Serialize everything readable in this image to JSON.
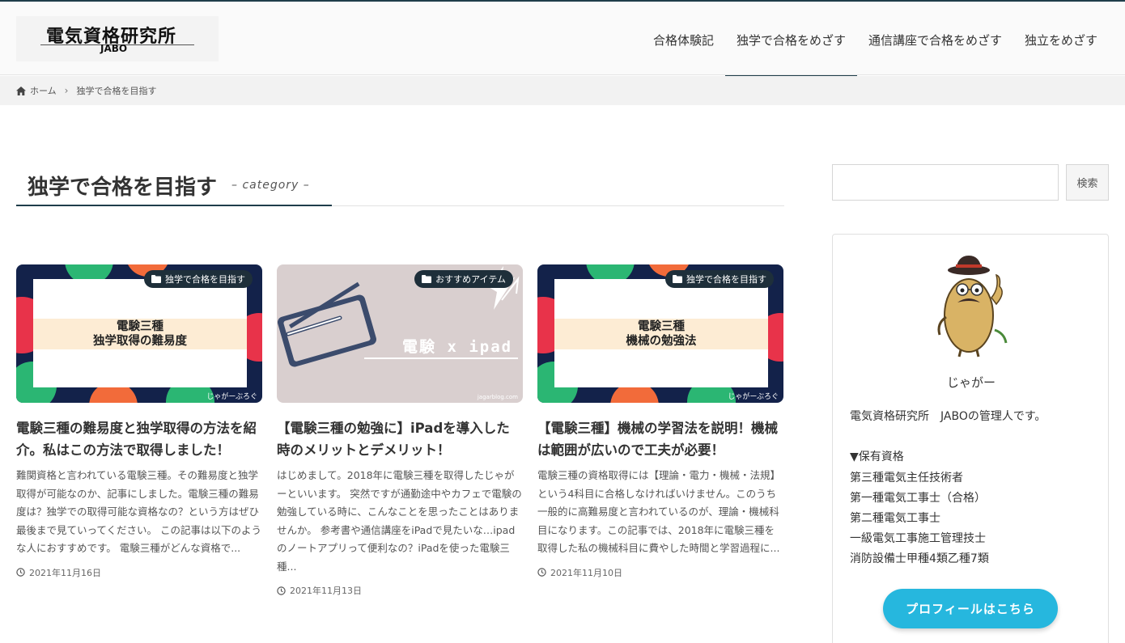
{
  "header": {
    "logo_title": "電気資格研究所",
    "logo_sub": "JABO",
    "nav": [
      {
        "label": "合格体験記"
      },
      {
        "label": "独学で合格をめざす"
      },
      {
        "label": "通信講座で合格をめざす"
      },
      {
        "label": "独立をめざす"
      }
    ],
    "active_nav": "独学で合格をめざす"
  },
  "breadcrumb": {
    "home": "ホーム",
    "current": "独学で合格を目指す"
  },
  "category": {
    "title": "独学で合格を目指す",
    "label": "– category –"
  },
  "posts": [
    {
      "badge": "独学で合格を目指す",
      "thumb_lines": [
        "電験三種",
        "独学取得の難易度"
      ],
      "thumb_foot": "じゃがーぶろぐ",
      "title": "電験三種の難易度と独学取得の方法を紹介。私はこの方法で取得しました！",
      "excerpt": "難関資格と言われている電験三種。その難易度と独学取得が可能なのか、記事にしました。電験三種の難易度は？独学での取得可能な資格なの？という方はぜひ最後まで見ていってください。 この記事は以下のような人におすすめです。 電験三種がどんな資格で...",
      "date": "2021年11月16日"
    },
    {
      "badge": "おすすめアイテム",
      "thumb_text": "電験 x ipad",
      "thumb_foot": "jagarblog.com",
      "title": "【電験三種の勉強に】iPadを導入した時のメリットとデメリット！",
      "excerpt": "はじめまして。2018年に電験三種を取得したじゃがーといいます。 突然ですが通勤途中やカフェで電験の勉強している時に、こんなことを思ったことはありませんか。 参考書や通信講座をiPadで見たいな…ipadのノートアプリって便利なの？iPadを使った電験三種...",
      "date": "2021年11月13日"
    },
    {
      "badge": "独学で合格を目指す",
      "thumb_lines": [
        "電験三種",
        "機械の勉強法"
      ],
      "thumb_foot": "じゃがーぶろぐ",
      "title": "【電験三種】機械の学習法を説明！機械は範囲が広いので工夫が必要！",
      "excerpt": "電験三種の資格取得には【理論・電力・機械・法規】という4科目に合格しなければいけません。このうち一般的に高難易度と言われているのが、理論・機械科目になります。この記事では、2018年に電験三種を取得した私の機械科目に費やした時間と学習過程に...",
      "date": "2021年11月10日"
    }
  ],
  "sidebar": {
    "search_button": "検索",
    "search_placeholder": "",
    "profile_name": "じゃがー",
    "profile_desc": "電気資格研究所　JABOの管理人です。",
    "qual_heading": "▼保有資格",
    "qualifications": [
      "第三種電気主任技術者",
      "第一種電気工事士（合格）",
      "第二種電気工事士",
      "一級電気工事施工管理技士",
      "消防設備士甲種4類乙種7類"
    ],
    "profile_button": "プロフィールはこちら"
  },
  "colors": {
    "accent": "#1f3d4a",
    "button": "#26b7de",
    "badge": "#1e2f3a",
    "thumb_navy": "#13224a"
  }
}
